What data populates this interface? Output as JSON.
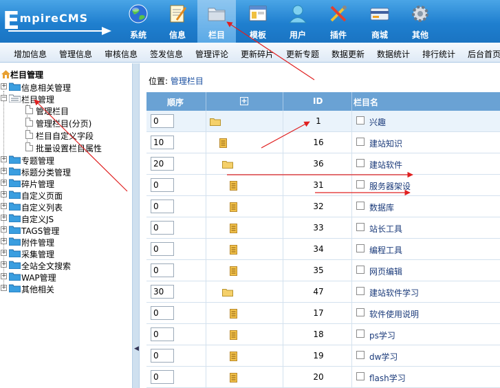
{
  "logo": {
    "first_letter": "E",
    "rest": "mpireCMS"
  },
  "nav": [
    {
      "label": "系统",
      "icon": "globe-icon"
    },
    {
      "label": "信息",
      "icon": "notepad-icon"
    },
    {
      "label": "栏目",
      "icon": "folder-icon",
      "active": true
    },
    {
      "label": "模板",
      "icon": "window-icon"
    },
    {
      "label": "用户",
      "icon": "user-icon"
    },
    {
      "label": "插件",
      "icon": "tools-icon"
    },
    {
      "label": "商城",
      "icon": "card-icon"
    },
    {
      "label": "其他",
      "icon": "gear-icon"
    }
  ],
  "menubar": [
    "增加信息",
    "管理信息",
    "审核信息",
    "签发信息",
    "管理评论",
    "更新碎片",
    "更新专题",
    "数据更新",
    "数据统计",
    "排行统计",
    "后台首页"
  ],
  "sidebar": {
    "root": "栏目管理",
    "items": [
      {
        "label": "信息相关管理",
        "pm": "+"
      },
      {
        "label": "栏目管理",
        "pm": "−"
      },
      {
        "label": "专题管理",
        "pm": "+"
      },
      {
        "label": "标题分类管理",
        "pm": "+"
      },
      {
        "label": "碎片管理",
        "pm": "+"
      },
      {
        "label": "自定义页面",
        "pm": "+"
      },
      {
        "label": "自定义列表",
        "pm": "+"
      },
      {
        "label": "自定义JS",
        "pm": "+"
      },
      {
        "label": "TAGS管理",
        "pm": "+"
      },
      {
        "label": "附件管理",
        "pm": "+"
      },
      {
        "label": "采集管理",
        "pm": "+"
      },
      {
        "label": "全站全文搜索",
        "pm": "+"
      },
      {
        "label": "WAP管理",
        "pm": "+"
      },
      {
        "label": "其他相关",
        "pm": "+"
      }
    ],
    "subitems": [
      "管理栏目",
      "管理栏目(分页)",
      "栏目自定义字段",
      "批量设置栏目属性"
    ]
  },
  "location": {
    "label": "位置:",
    "link": "管理栏目"
  },
  "table": {
    "headers": {
      "order": "顺序",
      "expand": "+",
      "id": "ID",
      "name": "栏目名"
    },
    "rows": [
      {
        "order": "0",
        "icon": "folder",
        "indent": 0,
        "id": "1",
        "name": "兴趣"
      },
      {
        "order": "10",
        "icon": "page",
        "indent": 1,
        "id": "16",
        "name": "建站知识"
      },
      {
        "order": "20",
        "icon": "folder",
        "indent": 1,
        "id": "36",
        "name": "建站软件"
      },
      {
        "order": "0",
        "icon": "page",
        "indent": 2,
        "id": "31",
        "name": "服务器架设"
      },
      {
        "order": "0",
        "icon": "page",
        "indent": 2,
        "id": "32",
        "name": "数据库"
      },
      {
        "order": "0",
        "icon": "page",
        "indent": 2,
        "id": "33",
        "name": "站长工具"
      },
      {
        "order": "0",
        "icon": "page",
        "indent": 2,
        "id": "34",
        "name": "编程工具"
      },
      {
        "order": "0",
        "icon": "page",
        "indent": 2,
        "id": "35",
        "name": "网页编辑"
      },
      {
        "order": "30",
        "icon": "folder",
        "indent": 1,
        "id": "47",
        "name": "建站软件学习"
      },
      {
        "order": "0",
        "icon": "page",
        "indent": 2,
        "id": "17",
        "name": "软件使用说明"
      },
      {
        "order": "0",
        "icon": "page",
        "indent": 2,
        "id": "18",
        "name": "ps学习"
      },
      {
        "order": "0",
        "icon": "page",
        "indent": 2,
        "id": "19",
        "name": "dw学习"
      },
      {
        "order": "0",
        "icon": "page",
        "indent": 2,
        "id": "20",
        "name": "flash学习"
      }
    ]
  },
  "colors": {
    "header_blue": "#1f7fcf",
    "table_header": "#6aa2d4",
    "annotation_red": "#e02020"
  }
}
